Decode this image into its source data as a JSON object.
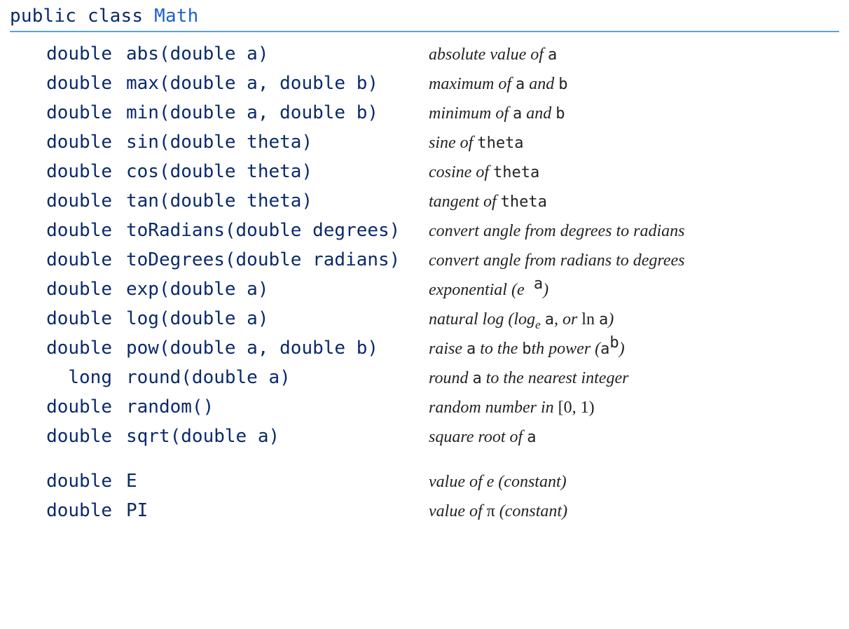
{
  "header": {
    "prefix": "public class ",
    "classname": "Math"
  },
  "methods": [
    {
      "ret": "double",
      "sig": "abs(double a)",
      "desc": [
        {
          "t": "absolute value of "
        },
        {
          "t": "a",
          "code": true
        }
      ]
    },
    {
      "ret": "double",
      "sig": "max(double a, double b)",
      "desc": [
        {
          "t": "maximum of "
        },
        {
          "t": "a",
          "code": true
        },
        {
          "t": " and "
        },
        {
          "t": "b",
          "code": true
        }
      ]
    },
    {
      "ret": "double",
      "sig": "min(double a, double b)",
      "desc": [
        {
          "t": "minimum of "
        },
        {
          "t": "a",
          "code": true
        },
        {
          "t": " and "
        },
        {
          "t": "b",
          "code": true
        }
      ]
    },
    {
      "ret": "double",
      "sig": "sin(double theta)",
      "desc": [
        {
          "t": "sine of "
        },
        {
          "t": "theta",
          "code": true
        }
      ]
    },
    {
      "ret": "double",
      "sig": "cos(double theta)",
      "desc": [
        {
          "t": "cosine of "
        },
        {
          "t": "theta",
          "code": true
        }
      ]
    },
    {
      "ret": "double",
      "sig": "tan(double theta)",
      "desc": [
        {
          "t": "tangent of "
        },
        {
          "t": "theta",
          "code": true
        }
      ]
    },
    {
      "ret": "double",
      "sig": "toRadians(double degrees)",
      "desc": [
        {
          "t": "convert angle from degrees to radians"
        }
      ]
    },
    {
      "ret": "double",
      "sig": "toDegrees(double radians)",
      "desc": [
        {
          "t": "convert angle from radians to degrees"
        }
      ]
    },
    {
      "ret": "double",
      "sig": "exp(double a)",
      "desc": [
        {
          "t": "exponential ("
        },
        {
          "t": "e"
        },
        {
          "t": " a",
          "code": true,
          "sup": true
        },
        {
          "t": ")"
        }
      ]
    },
    {
      "ret": "double",
      "sig": "log(double a)",
      "desc": [
        {
          "t": "natural log (log"
        },
        {
          "t": "e",
          "sub": true
        },
        {
          "t": " "
        },
        {
          "t": "a",
          "code": true
        },
        {
          "t": ", or "
        },
        {
          "t": "ln",
          "lit": true
        },
        {
          "t": " "
        },
        {
          "t": "a",
          "code": true
        },
        {
          "t": ")"
        }
      ]
    },
    {
      "ret": "double",
      "sig": "pow(double a, double b)",
      "desc": [
        {
          "t": "raise "
        },
        {
          "t": "a",
          "code": true
        },
        {
          "t": " to the "
        },
        {
          "t": "b",
          "code": true
        },
        {
          "t": "th power ("
        },
        {
          "t": "a",
          "code": true
        },
        {
          "t": "b",
          "code": true,
          "sup": true
        },
        {
          "t": ")"
        }
      ]
    },
    {
      "ret": "long",
      "sig": "round(double a)",
      "desc": [
        {
          "t": "round "
        },
        {
          "t": "a",
          "code": true
        },
        {
          "t": "  to the nearest integer"
        }
      ]
    },
    {
      "ret": "double",
      "sig": "random()",
      "desc": [
        {
          "t": "random number in "
        },
        {
          "t": "[0, 1)",
          "lit": true
        }
      ]
    },
    {
      "ret": "double",
      "sig": "sqrt(double a)",
      "desc": [
        {
          "t": "square root of "
        },
        {
          "t": "a",
          "code": true
        }
      ]
    }
  ],
  "constants": [
    {
      "ret": "double",
      "sig": "E",
      "desc": [
        {
          "t": "value of e (constant)"
        }
      ]
    },
    {
      "ret": "double",
      "sig": "PI",
      "desc": [
        {
          "t": "value of "
        },
        {
          "t": "π",
          "lit": true
        },
        {
          "t": " (constant)"
        }
      ]
    }
  ]
}
